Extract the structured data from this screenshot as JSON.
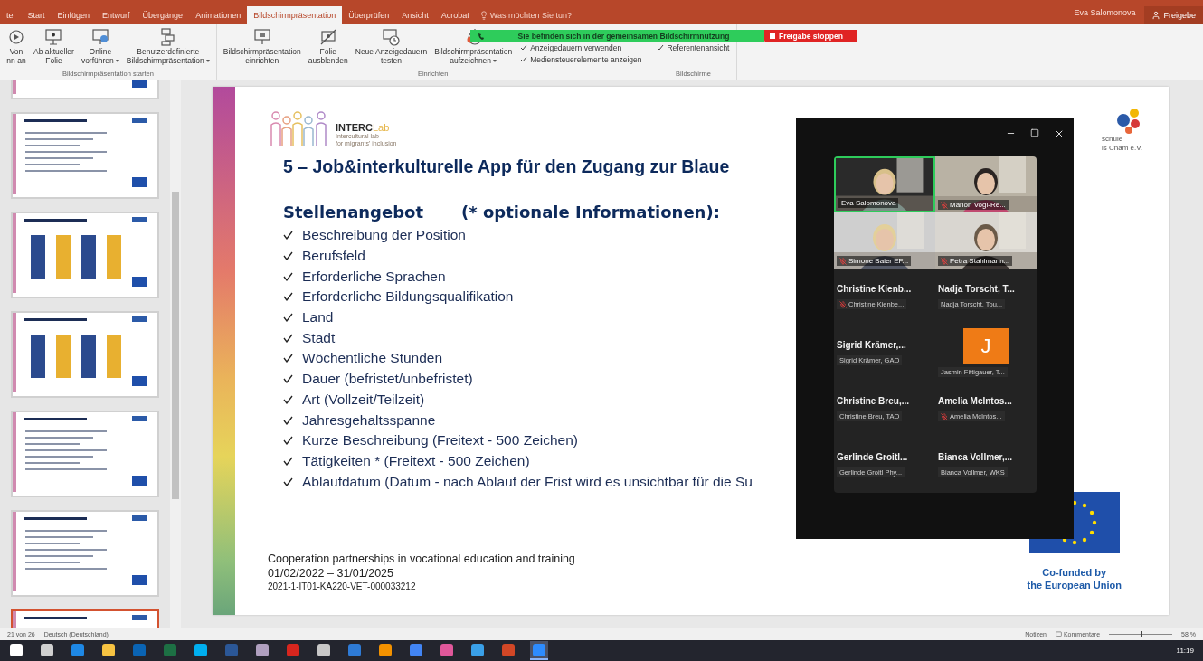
{
  "ribbon": {
    "tabs": [
      {
        "label": "tei",
        "selected": false
      },
      {
        "label": "Start",
        "selected": false
      },
      {
        "label": "Einfügen",
        "selected": false
      },
      {
        "label": "Entwurf",
        "selected": false
      },
      {
        "label": "Übergänge",
        "selected": false
      },
      {
        "label": "Animationen",
        "selected": false
      },
      {
        "label": "Bildschirmpräsentation",
        "selected": true
      },
      {
        "label": "Überprüfen",
        "selected": false
      },
      {
        "label": "Ansicht",
        "selected": false
      },
      {
        "label": "Acrobat",
        "selected": false
      }
    ],
    "search": {
      "placeholder": "Was möchten Sie tun?"
    },
    "user": "Eva Salomonova",
    "share": "Freigebe",
    "groups": [
      {
        "label": "Bildschirmpräsentation starten",
        "items": [
          {
            "kind": "button",
            "lines": [
              "Von",
              "nn an"
            ],
            "dropdown": false
          },
          {
            "kind": "button",
            "lines": [
              "Ab aktueller",
              "Folie"
            ],
            "dropdown": false
          },
          {
            "kind": "button",
            "lines": [
              "Online",
              "vorführen"
            ],
            "dropdown": true
          },
          {
            "kind": "button",
            "lines": [
              "Benutzerdefinierte",
              "Bildschirmpräsentation"
            ],
            "dropdown": true
          }
        ]
      },
      {
        "label": "Einrichten",
        "items": [
          {
            "kind": "button",
            "lines": [
              "Bildschirmpräsentation",
              "einrichten"
            ],
            "dropdown": false
          },
          {
            "kind": "button",
            "lines": [
              "Folie",
              "ausblenden"
            ],
            "dropdown": false
          },
          {
            "kind": "button",
            "lines": [
              "Neue Anzeigedauern",
              "testen"
            ],
            "dropdown": false
          },
          {
            "kind": "button",
            "lines": [
              "Bildschirmpräsentation",
              "aufzeichnen"
            ],
            "dropdown": true
          },
          {
            "kind": "checks",
            "checks": [
              {
                "label": "Anzeigedauern verwenden",
                "checked": true
              },
              {
                "label": "Mediensteuerelemente anzeigen",
                "checked": true
              }
            ]
          }
        ]
      },
      {
        "label": "Bildschirme",
        "items": [
          {
            "kind": "checks",
            "checks": [
              {
                "label": "Referentenansicht",
                "checked": true
              }
            ]
          }
        ]
      }
    ]
  },
  "sharing_bar": {
    "message": "Sie befinden sich in der gemeinsamen Bildschirmnutzung",
    "stop": "Freigabe stoppen"
  },
  "thumbnails": [
    {
      "kind": "text",
      "selected": false
    },
    {
      "kind": "text",
      "selected": false
    },
    {
      "kind": "chart",
      "selected": false
    },
    {
      "kind": "chart",
      "selected": false
    },
    {
      "kind": "text",
      "selected": false
    },
    {
      "kind": "text",
      "selected": false
    },
    {
      "kind": "text",
      "selected": true
    }
  ],
  "slide": {
    "logo": {
      "name": "INTERC",
      "accent": "Lab",
      "tagline": [
        "Intercultural lab",
        "for migrants' inclusion"
      ]
    },
    "partner_logo": {
      "lines": [
        "schule",
        "is Cham e.V."
      ]
    },
    "title": "5 – Job&interkulturelle App für den Zugang zur Blaue",
    "heading": "Stellenangebot",
    "heading_note": "(* optionale Informationen):",
    "items": [
      "Beschreibung der Position",
      "Berufsfeld",
      "Erforderliche Sprachen",
      "Erforderliche Bildungsqualifikation",
      "Land",
      "Stadt",
      "Wöchentliche Stunden",
      "Dauer (befristet/unbefristet)",
      "Art (Vollzeit/Teilzeit)",
      "Jahresgehaltsspanne",
      "Kurze Beschreibung (Freitext - 500 Zeichen)",
      "Tätigkeiten * (Freitext - 500 Zeichen)",
      "Ablaufdatum (Datum - nach Ablauf der Frist wird es unsichtbar für die Su"
    ],
    "footer": [
      "Cooperation partnerships in vocational education and training",
      "01/02/2022 – 31/01/2025",
      "2021-1-IT01-KA220-VET-000033212"
    ],
    "eu_label": [
      "Co-funded by",
      "the European Union"
    ]
  },
  "meeting": {
    "tiles": [
      {
        "kind": "video",
        "name": "Eva Salomonova",
        "muted": false,
        "speaking": true
      },
      {
        "kind": "video",
        "name": "Marion Vogl-Re...",
        "muted": true,
        "speaking": false
      },
      {
        "kind": "video",
        "name": "Simone Baier EF...",
        "muted": true,
        "speaking": false
      },
      {
        "kind": "video",
        "name": "Petra Stahlmann...",
        "muted": true,
        "speaking": false
      },
      {
        "kind": "name",
        "title": "Christine Kienb...",
        "label": "Christine Kienbe...",
        "muted": true
      },
      {
        "kind": "name",
        "title": "Nadja Torscht, T...",
        "label": "Nadja Torscht, Tou...",
        "muted": false
      },
      {
        "kind": "name",
        "title": "Sigrid Krämer,...",
        "label": "Sigrid Krämer, GAO",
        "muted": false
      },
      {
        "kind": "avatar",
        "initial": "J",
        "label": "Jasmin Fittigauer, T...",
        "muted": false
      },
      {
        "kind": "name",
        "title": "Christine Breu,...",
        "label": "Christine Breu,  TAO",
        "muted": false
      },
      {
        "kind": "name",
        "title": "Amelia McIntos...",
        "label": "Amelia McIntos...",
        "muted": true
      },
      {
        "kind": "name",
        "title": "Gerlinde Groitl...",
        "label": "Gerlinde Groitl Phy...",
        "muted": false
      },
      {
        "kind": "name",
        "title": "Bianca Vollmer,...",
        "label": "Bianca Vollmer, WKS",
        "muted": false
      }
    ]
  },
  "status_bar": {
    "slide_count": "21 von 26",
    "language": "Deutsch (Deutschland)",
    "notes": "Notizen",
    "comments": "Kommentare",
    "zoom": {
      "level": 0.5,
      "reading": "58 %"
    }
  },
  "taskbar": {
    "apps": [
      {
        "color": "#ffffff",
        "selected": false
      },
      {
        "color": "#d0d0d0",
        "selected": false
      },
      {
        "color": "#1e88e5",
        "selected": false
      },
      {
        "color": "#f6c342",
        "selected": false
      },
      {
        "color": "#0a64b4",
        "selected": false
      },
      {
        "color": "#1d7044",
        "selected": false
      },
      {
        "color": "#00aff0",
        "selected": false
      },
      {
        "color": "#2b5797",
        "selected": false
      },
      {
        "color": "#b0a0c0",
        "selected": false
      },
      {
        "color": "#d7261e",
        "selected": false
      },
      {
        "color": "#c8c8c8",
        "selected": false
      },
      {
        "color": "#2e7bd6",
        "selected": false
      },
      {
        "color": "#f39200",
        "selected": false
      },
      {
        "color": "#4285f4",
        "selected": false
      },
      {
        "color": "#e0589b",
        "selected": false
      },
      {
        "color": "#3aa0e8",
        "selected": false
      },
      {
        "color": "#d24726",
        "selected": false
      },
      {
        "color": "#2d8cff",
        "selected": true
      }
    ],
    "time": "11:19"
  }
}
